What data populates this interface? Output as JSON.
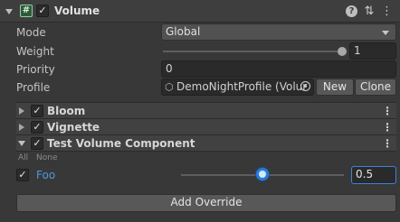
{
  "header": {
    "title": "Volume",
    "component_icon_glyph": "#",
    "checkbox_glyph": "✓",
    "help_glyph": "?",
    "settings_glyph": "⇅",
    "kebab_glyph": "⋮"
  },
  "properties": {
    "mode": {
      "label": "Mode",
      "value": "Global"
    },
    "weight": {
      "label": "Weight",
      "value": "1",
      "slider_fraction": 1.0
    },
    "priority": {
      "label": "Priority",
      "value": "0"
    },
    "profile": {
      "label": "Profile",
      "value": "DemoNightProfile (Volur",
      "new_label": "New",
      "clone_label": "Clone"
    }
  },
  "overrides": [
    {
      "title": "Bloom",
      "expanded": false
    },
    {
      "title": "Vignette",
      "expanded": false
    },
    {
      "title": "Test Volume Component",
      "expanded": true
    }
  ],
  "test_component": {
    "all_label": "All",
    "none_label": "None",
    "foo": {
      "label": "Foo",
      "value": "0.5",
      "slider_fraction": 0.5
    }
  },
  "add_override_label": "Add Override"
}
